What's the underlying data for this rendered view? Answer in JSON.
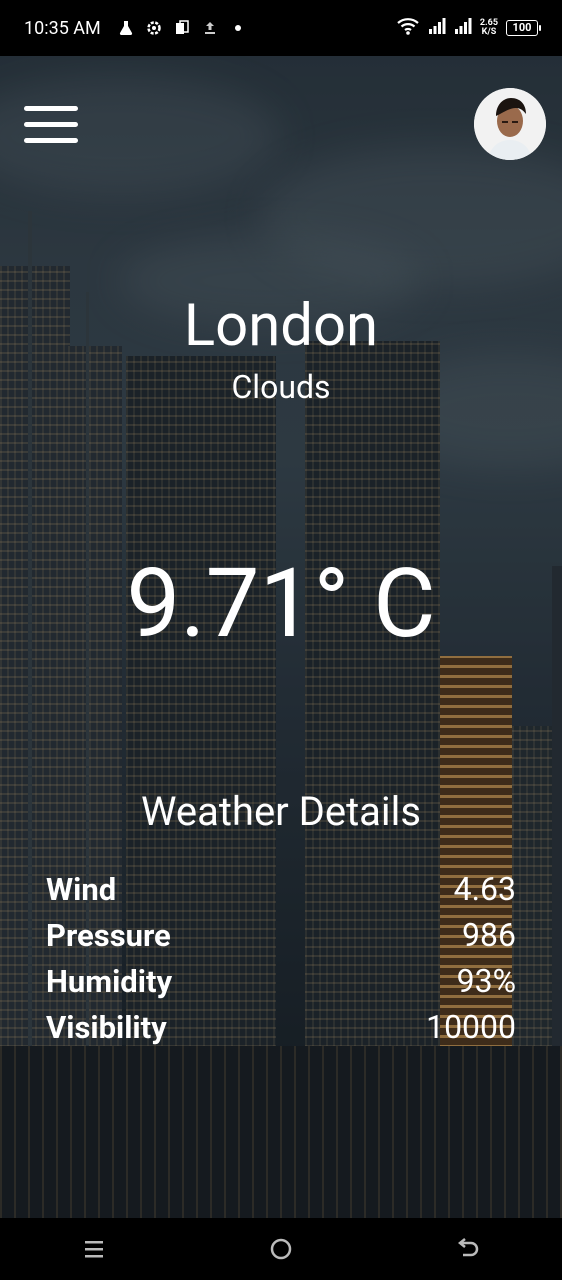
{
  "status_bar": {
    "time": "10:35 AM",
    "net_speed_value": "2.65",
    "net_speed_unit": "K/S",
    "battery": "100"
  },
  "weather": {
    "city": "London",
    "condition": "Clouds",
    "temperature": "9.71° C"
  },
  "details": {
    "title": "Weather Details",
    "rows": [
      {
        "label": "Wind",
        "value": "4.63"
      },
      {
        "label": "Pressure",
        "value": "986"
      },
      {
        "label": "Humidity",
        "value": "93%"
      },
      {
        "label": "Visibility",
        "value": "10000"
      }
    ]
  },
  "icons": {
    "menu": "hamburger-icon",
    "avatar": "user-avatar",
    "nav_recent": "recent-apps-icon",
    "nav_home": "home-icon",
    "nav_back": "back-icon"
  }
}
